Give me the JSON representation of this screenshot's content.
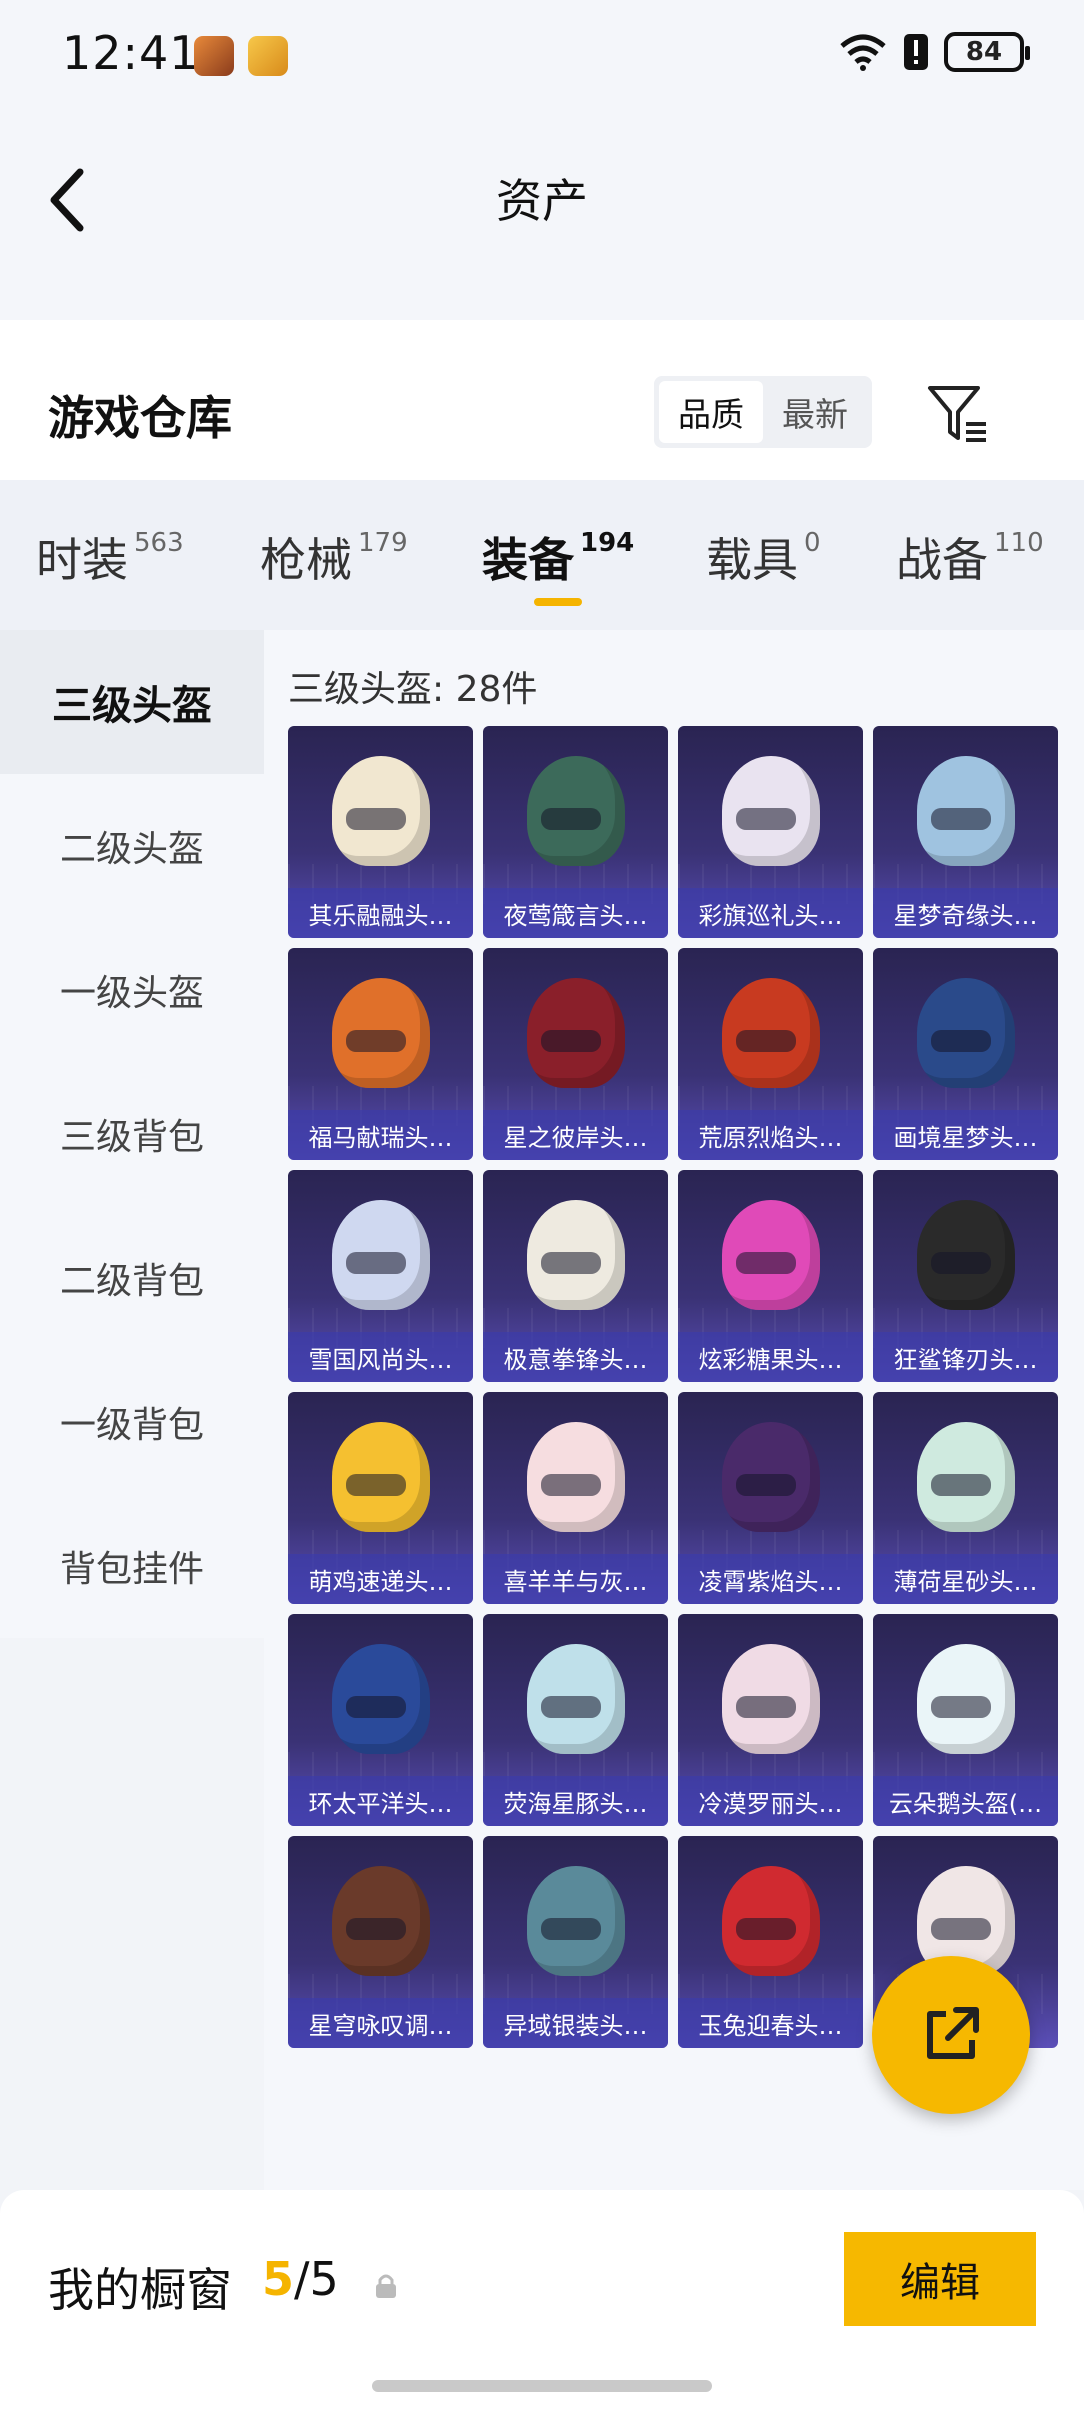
{
  "status_bar": {
    "time": "12:41",
    "battery": "84"
  },
  "nav": {
    "title": "资产"
  },
  "header": {
    "title": "游戏仓库",
    "sort_options": [
      "品质",
      "最新"
    ],
    "sort_active": "品质"
  },
  "tabs": [
    {
      "label": "时装",
      "count": "563"
    },
    {
      "label": "枪械",
      "count": "179"
    },
    {
      "label": "装备",
      "count": "194"
    },
    {
      "label": "载具",
      "count": "0"
    },
    {
      "label": "战备",
      "count": "110"
    }
  ],
  "side_menu": [
    "三级头盔",
    "二级头盔",
    "一级头盔",
    "三级背包",
    "二级背包",
    "一级背包",
    "背包挂件"
  ],
  "section_title": "三级头盔: 28件",
  "items": [
    "其乐融融头…",
    "夜莺箴言头…",
    "彩旗巡礼头…",
    "星梦奇缘头…",
    "福马献瑞头…",
    "星之彼岸头…",
    "荒原烈焰头…",
    "画境星梦头…",
    "雪国风尚头…",
    "极意拳锋头…",
    "炫彩糖果头…",
    "狂鲨锋刃头…",
    "萌鸡速递头…",
    "喜羊羊与灰…",
    "凌霄紫焰头…",
    "薄荷星砂头…",
    "环太平洋头…",
    "荧海星豚头…",
    "冷漠罗丽头…",
    "云朵鹅头盔(…",
    "星穹咏叹调…",
    "异域银装头…",
    "玉兔迎春头…",
    ""
  ],
  "bottom": {
    "title": "我的橱窗",
    "current": "5",
    "separator": "/",
    "total": "5",
    "edit_label": "编辑"
  },
  "colors": {
    "accent": "#f6b800",
    "card_bg": "#3a3275",
    "label_bg": "#4545b0"
  }
}
